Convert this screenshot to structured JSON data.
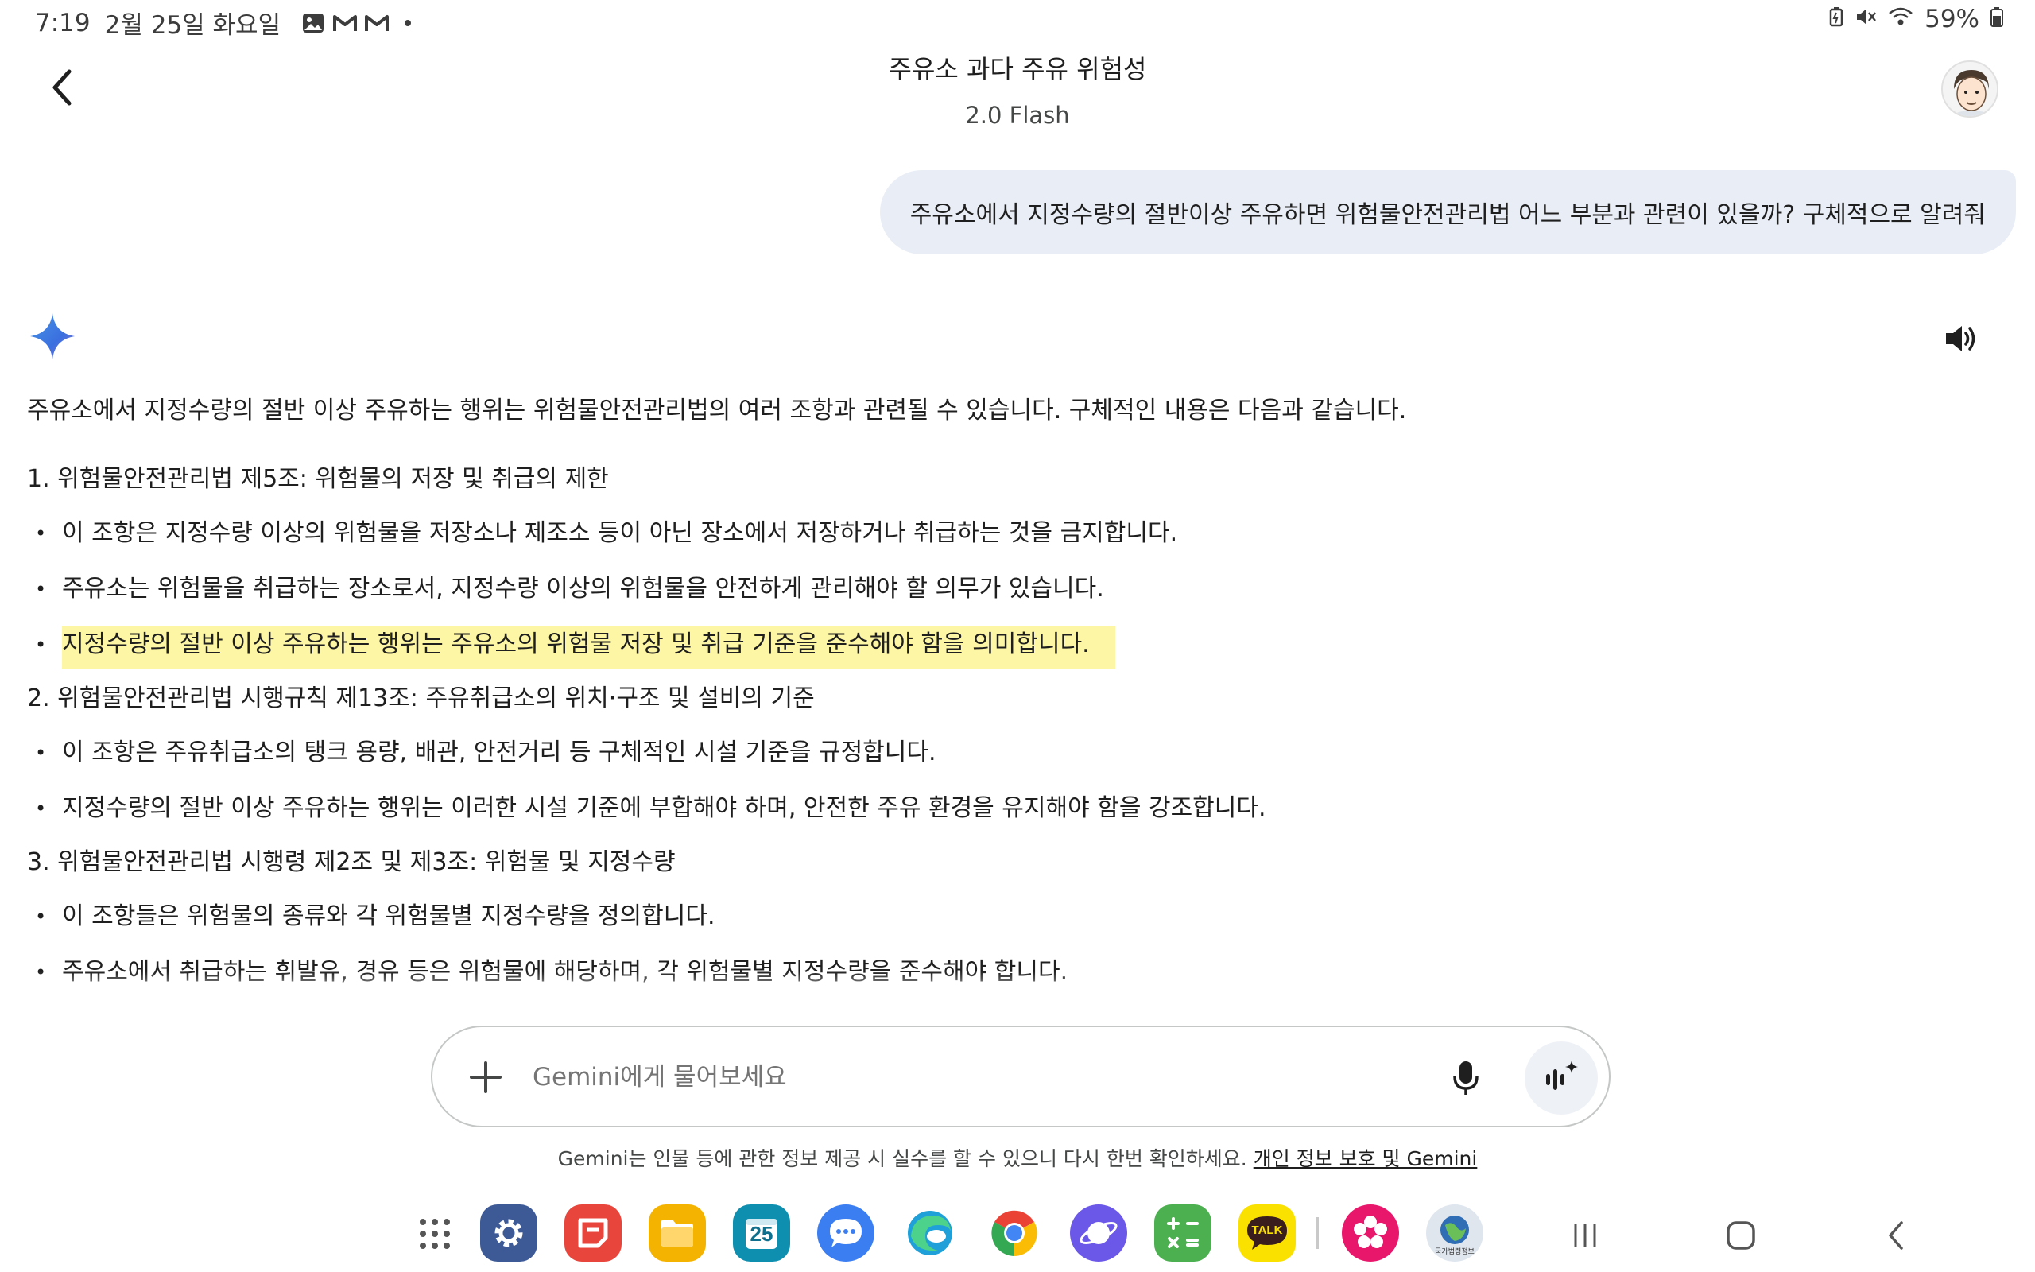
{
  "status_bar": {
    "time": "7:19",
    "date": "2월 25일 화요일",
    "notification_icons": [
      "gallery-icon",
      "gmail-icon",
      "gmail-icon"
    ],
    "battery": "59%",
    "system_icons": [
      "battery-saver-icon",
      "mute-icon",
      "wifi-icon",
      "battery-icon"
    ]
  },
  "header": {
    "title": "주유소 과다 주유 위험성",
    "model": "2.0 Flash"
  },
  "user_message": "주유소에서 지정수량의 절반이상 주유하면 위험물안전관리법 어느 부분과 관련이 있을까? 구체적으로 알려줘",
  "response": {
    "intro": "주유소에서 지정수량의 절반 이상 주유하는 행위는 위험물안전관리법의 여러 조항과 관련될 수 있습니다. 구체적인 내용은 다음과 같습니다.",
    "sections": [
      {
        "heading": "1. 위험물안전관리법 제5조: 위험물의 저장 및 취급의 제한",
        "bullets": [
          "이 조항은 지정수량 이상의 위험물을 저장소나 제조소 등이 아닌 장소에서 저장하거나 취급하는 것을 금지합니다.",
          "주유소는 위험물을 취급하는 장소로서, 지정수량 이상의 위험물을 안전하게 관리해야 할 의무가 있습니다.",
          "지정수량의 절반 이상 주유하는 행위는 주유소의 위험물 저장 및 취급 기준을 준수해야 함을 의미합니다."
        ]
      },
      {
        "heading": "2. 위험물안전관리법 시행규칙 제13조: 주유취급소의 위치·구조 및 설비의 기준",
        "bullets": [
          "이 조항은 주유취급소의 탱크 용량, 배관, 안전거리 등 구체적인 시설 기준을 규정합니다.",
          "지정수량의 절반 이상 주유하는 행위는 이러한 시설 기준에 부합해야 하며, 안전한 주유 환경을 유지해야 함을 강조합니다."
        ]
      },
      {
        "heading": "3. 위험물안전관리법 시행령 제2조 및 제3조: 위험물 및 지정수량",
        "bullets": [
          "이 조항들은 위험물의 종류와 각 위험물별 지정수량을 정의합니다.",
          "주유소에서 취급하는 휘발유, 경유 등은 위험물에 해당하며, 각 위험물별 지정수량을 준수해야 합니다."
        ]
      }
    ]
  },
  "input": {
    "placeholder": "Gemini에게 물어보세요"
  },
  "disclaimer": {
    "text": "Gemini는 인물 등에 관한 정보 제공 시 실수를 할 수 있으니 다시 한번 확인하세요. ",
    "link": "개인 정보 보호 및 Gemini"
  },
  "dock": {
    "apps": [
      {
        "name": "settings",
        "color": "#3d5a96"
      },
      {
        "name": "samsung-notes",
        "color": "#e8453c"
      },
      {
        "name": "my-files",
        "color": "#f5b301"
      },
      {
        "name": "calendar",
        "color": "#0f8fb0",
        "label": "25"
      },
      {
        "name": "messages",
        "color": "#3b7ef2"
      },
      {
        "name": "edge",
        "color": "#1fa0d8"
      },
      {
        "name": "chrome",
        "color": "#ffffff"
      },
      {
        "name": "samsung-internet",
        "color": "#6b58e8"
      },
      {
        "name": "calculator",
        "color": "#4caf50"
      },
      {
        "name": "kakaotalk",
        "color": "#fae100",
        "label": "TALK"
      },
      {
        "name": "blossom-app",
        "color": "#e8176b"
      },
      {
        "name": "national-law-info",
        "color": "#dfe6ee",
        "label": "국가법령정보"
      }
    ]
  }
}
